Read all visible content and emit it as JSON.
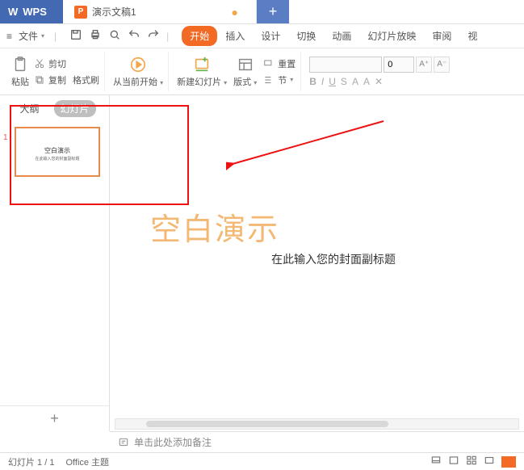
{
  "titlebar": {
    "app": "WPS",
    "doc_name": "演示文稿1",
    "doc_icon": "P"
  },
  "menubar": {
    "file": "文件",
    "tabs": [
      "开始",
      "插入",
      "设计",
      "切换",
      "动画",
      "幻灯片放映",
      "审阅",
      "视"
    ],
    "active": 0
  },
  "toolbar": {
    "paste": "粘贴",
    "cut": "剪切",
    "copy": "复制",
    "format_painter": "格式刷",
    "from_current": "从当前开始",
    "new_slide": "新建幻灯片",
    "layout": "版式",
    "section": "节",
    "reset": "重置",
    "font_size": "0",
    "font_name": ""
  },
  "sidebar": {
    "outline": "大纲",
    "slides": "幻灯片",
    "slide_number": "1",
    "thumb_title": "空白演示",
    "thumb_sub": "在此输入您的封面副标题"
  },
  "slide": {
    "title": "空白演示",
    "subtitle": "在此输入您的封面副标题"
  },
  "notes": {
    "placeholder": "单击此处添加备注"
  },
  "status": {
    "counter": "幻灯片 1 / 1",
    "theme": "Office 主题"
  }
}
